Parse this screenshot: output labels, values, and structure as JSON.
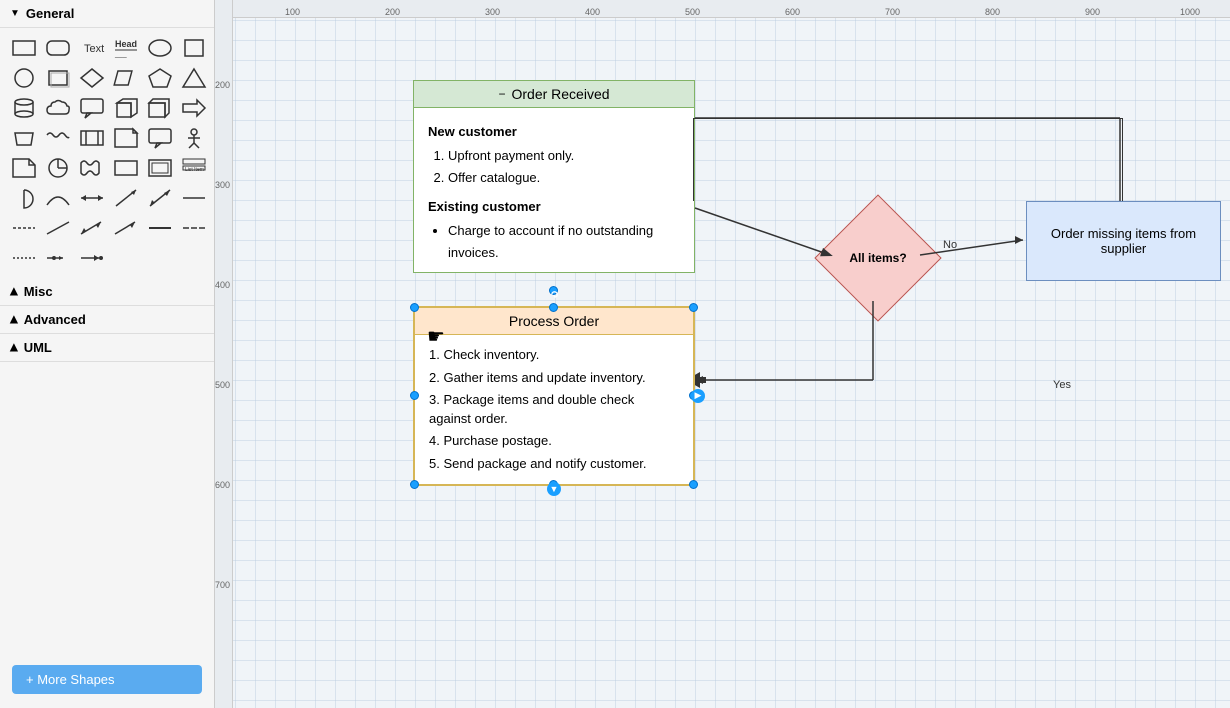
{
  "leftPanel": {
    "sections": [
      {
        "id": "general",
        "label": "General",
        "expanded": true
      },
      {
        "id": "misc",
        "label": "Misc",
        "expanded": false
      },
      {
        "id": "advanced",
        "label": "Advanced",
        "expanded": false
      },
      {
        "id": "uml",
        "label": "UML",
        "expanded": false
      }
    ],
    "moreShapesLabel": "+ More Shapes"
  },
  "diagram": {
    "orderReceived": {
      "title": "Order Received",
      "newCustomerTitle": "New customer",
      "newCustomerItems": [
        "Upfront payment only.",
        "Offer catalogue."
      ],
      "existingCustomerTitle": "Existing customer",
      "existingCustomerItems": [
        "Charge to account if no outstanding invoices."
      ]
    },
    "processOrder": {
      "title": "Process Order",
      "steps": [
        "1. Check inventory.",
        "2. Gather items and update inventory.",
        "3. Package items and double check against order.",
        "4. Purchase postage.",
        "5. Send package and notify customer."
      ]
    },
    "diamond": {
      "label": "All items?"
    },
    "supplierBox": {
      "label": "Order missing items from supplier"
    },
    "connectors": {
      "noLabel": "No",
      "yesLabel": "Yes"
    }
  }
}
